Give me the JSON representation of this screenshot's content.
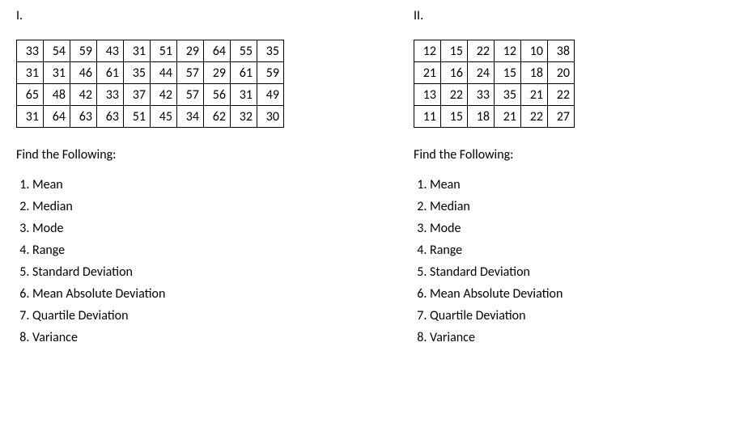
{
  "sections": [
    {
      "title": "I.",
      "table": [
        [
          33,
          54,
          59,
          43,
          31,
          51,
          29,
          64,
          55,
          35
        ],
        [
          31,
          31,
          46,
          61,
          35,
          44,
          57,
          29,
          61,
          59
        ],
        [
          65,
          48,
          42,
          33,
          37,
          42,
          57,
          56,
          31,
          49
        ],
        [
          31,
          64,
          63,
          63,
          51,
          45,
          34,
          62,
          32,
          30
        ]
      ],
      "prompt": "Find the Following:",
      "items": [
        "Mean",
        "Median",
        "Mode",
        "Range",
        "Standard Deviation",
        "Mean Absolute Deviation",
        "Quartile Deviation",
        "Variance"
      ]
    },
    {
      "title": "II.",
      "table": [
        [
          12,
          15,
          22,
          12,
          10,
          38
        ],
        [
          21,
          16,
          24,
          15,
          18,
          20
        ],
        [
          13,
          22,
          33,
          35,
          21,
          22
        ],
        [
          11,
          15,
          18,
          21,
          22,
          27
        ]
      ],
      "prompt": "Find the Following:",
      "items": [
        "Mean",
        "Median",
        "Mode",
        "Range",
        "Standard Deviation",
        "Mean Absolute Deviation",
        "Quartile Deviation",
        "Variance"
      ]
    }
  ]
}
